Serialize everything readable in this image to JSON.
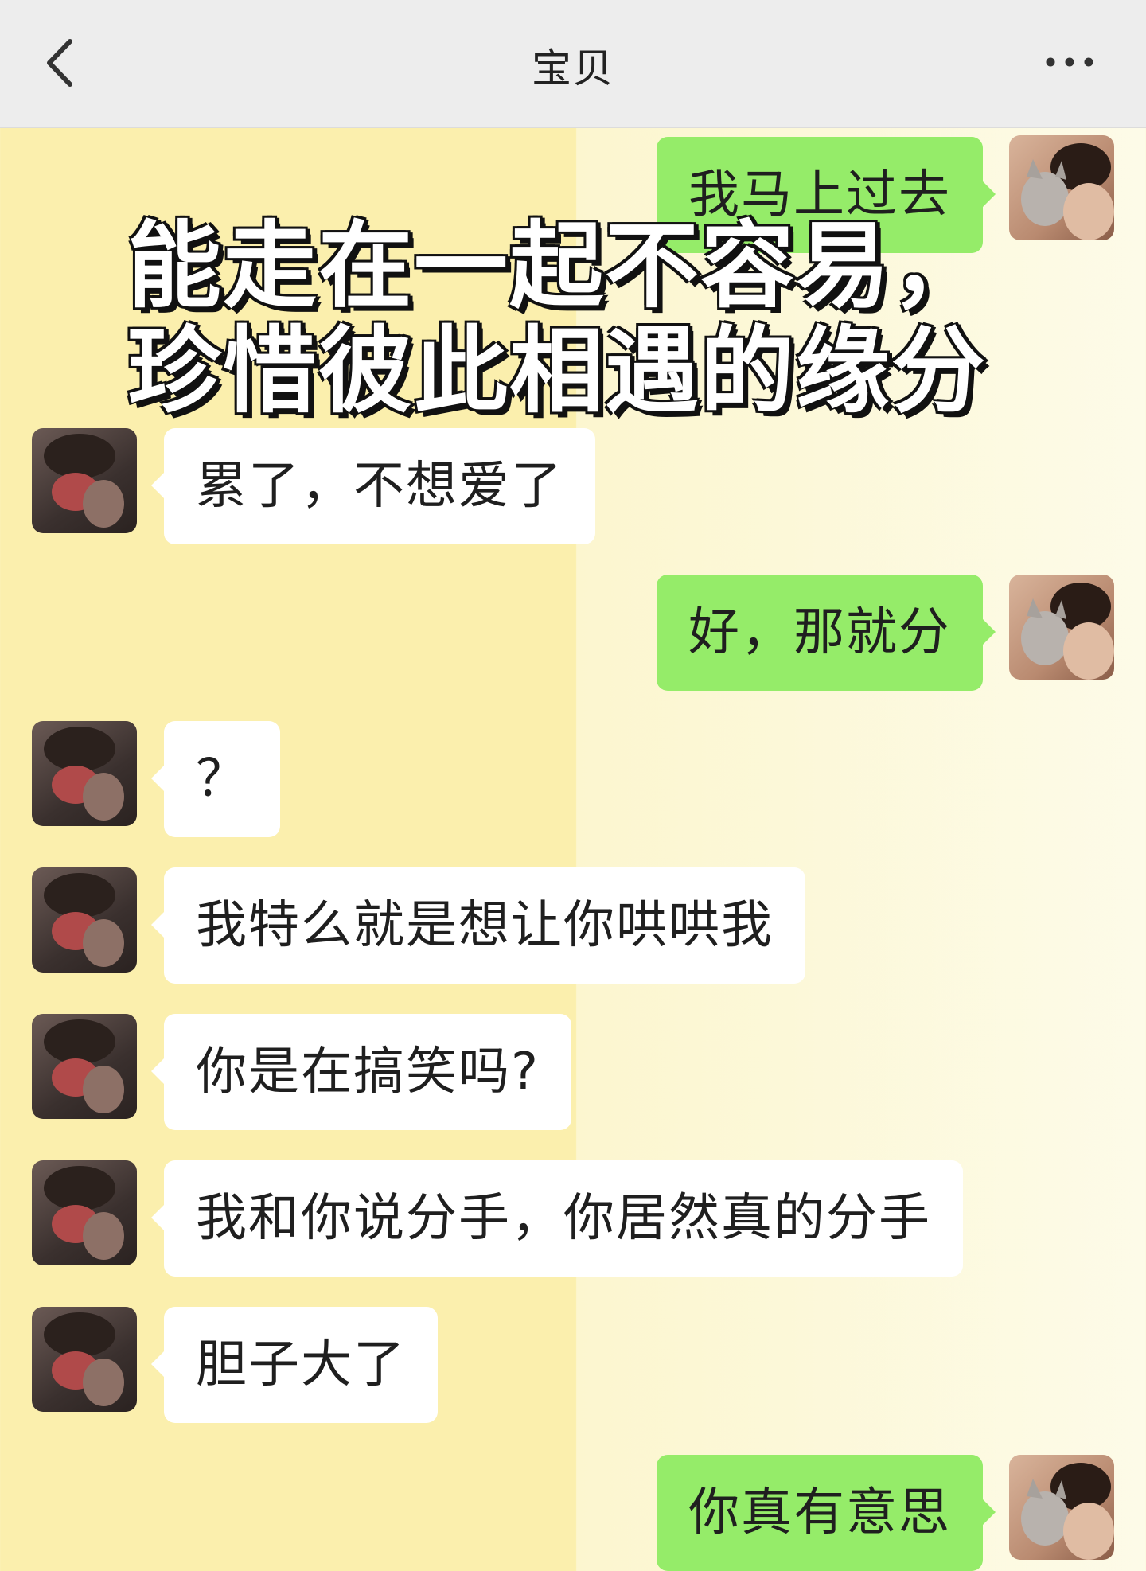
{
  "header": {
    "title": "宝贝",
    "back_icon": "chevron-left-icon",
    "more_icon": "more-dots-icon"
  },
  "overlay": {
    "caption": "能走在一起不容易，珍惜彼此相遇的缘分"
  },
  "messages": [
    {
      "side": "out",
      "text": "我马上过去"
    },
    {
      "side": "in",
      "text": "累了，不想爱了"
    },
    {
      "side": "out",
      "text": "好，那就分"
    },
    {
      "side": "in",
      "text": "？"
    },
    {
      "side": "in",
      "text": "我特么就是想让你哄哄我"
    },
    {
      "side": "in",
      "text": "你是在搞笑吗?"
    },
    {
      "side": "in",
      "text": "我和你说分手，你居然真的分手"
    },
    {
      "side": "in",
      "text": "胆子大了"
    },
    {
      "side": "out",
      "text": "你真有意思"
    }
  ],
  "colors": {
    "incoming_bubble": "#ffffff",
    "outgoing_bubble": "#95ec69",
    "header_bg": "#ededed"
  }
}
